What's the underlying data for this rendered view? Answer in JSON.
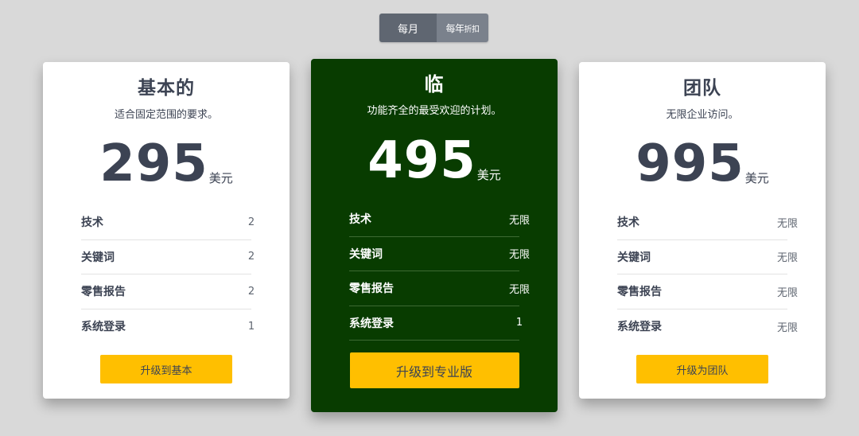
{
  "toggle": {
    "monthly_label": "每月",
    "yearly_label": "每年",
    "yearly_suffix": "折扣"
  },
  "plans": [
    {
      "name": "基本的",
      "description": "适合固定范围的要求。",
      "price": "295",
      "currency": "美元",
      "features": [
        {
          "label": "技术",
          "value": "2"
        },
        {
          "label": "关键词",
          "value": "2"
        },
        {
          "label": "零售报告",
          "value": "2"
        },
        {
          "label": "系统登录",
          "value": "1"
        }
      ],
      "cta": "升级到基本"
    },
    {
      "name": "临",
      "description": "功能齐全的最受欢迎的计划。",
      "price": "495",
      "currency": "美元",
      "features": [
        {
          "label": "技术",
          "value": "无限"
        },
        {
          "label": "关键词",
          "value": "无限"
        },
        {
          "label": "零售报告",
          "value": "无限"
        },
        {
          "label": "系统登录",
          "value": "1"
        }
      ],
      "cta": "升级到专业版"
    },
    {
      "name": "团队",
      "description": "无限企业访问。",
      "price": "995",
      "currency": "美元",
      "features": [
        {
          "label": "技术",
          "value": "无限"
        },
        {
          "label": "关键词",
          "value": "无限"
        },
        {
          "label": "零售报告",
          "value": "无限"
        },
        {
          "label": "系统登录",
          "value": "无限"
        }
      ],
      "cta": "升级为团队"
    }
  ],
  "colors": {
    "background": "#d9d9d9",
    "card": "#ffffff",
    "featured_card": "#083c00",
    "accent_button": "#ffbf00",
    "text": "#3c4353"
  }
}
